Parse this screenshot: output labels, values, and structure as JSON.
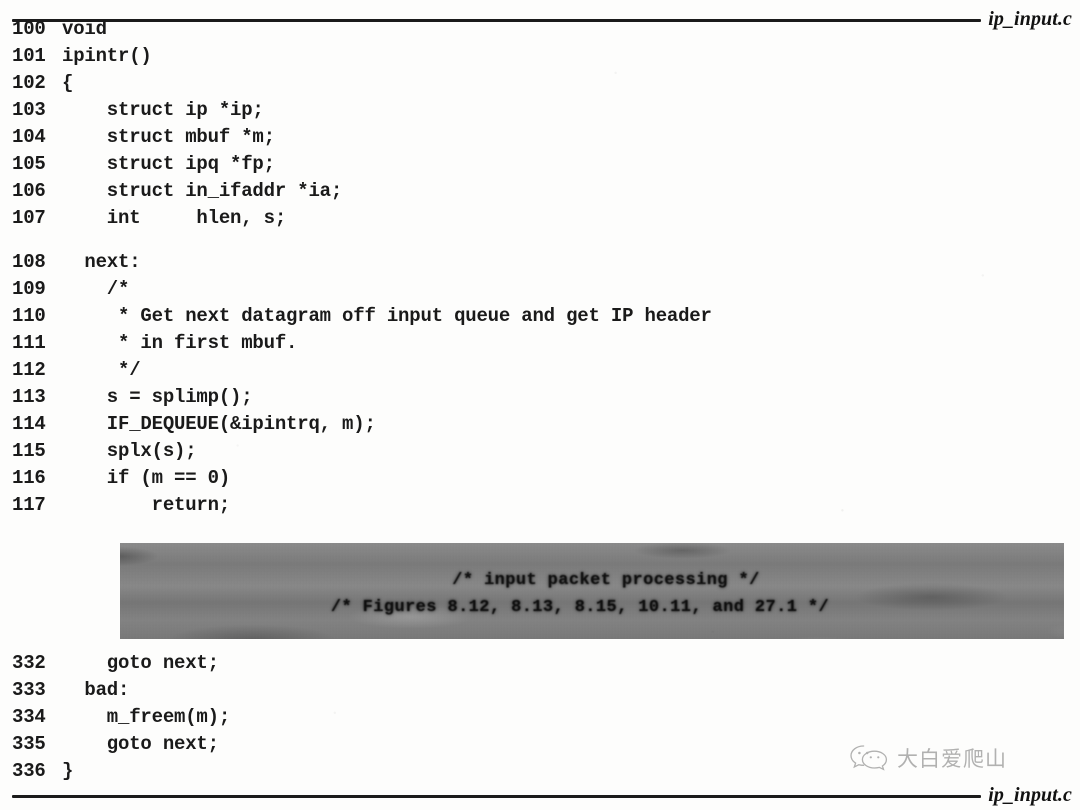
{
  "document": {
    "header_filename": "ip_input.c",
    "footer_filename": "ip_input.c"
  },
  "listing": {
    "lines": [
      {
        "num": "100",
        "code": "void"
      },
      {
        "num": "101",
        "code": "ipintr()"
      },
      {
        "num": "102",
        "code": "{"
      },
      {
        "num": "103",
        "code": "    struct ip *ip;"
      },
      {
        "num": "104",
        "code": "    struct mbuf *m;"
      },
      {
        "num": "105",
        "code": "    struct ipq *fp;"
      },
      {
        "num": "106",
        "code": "    struct in_ifaddr *ia;"
      },
      {
        "num": "107",
        "code": "    int     hlen, s;"
      },
      {
        "num": "108",
        "code": "  next:"
      },
      {
        "num": "109",
        "code": "    /*"
      },
      {
        "num": "110",
        "code": "     * Get next datagram off input queue and get IP header"
      },
      {
        "num": "111",
        "code": "     * in first mbuf."
      },
      {
        "num": "112",
        "code": "     */"
      },
      {
        "num": "113",
        "code": "    s = splimp();"
      },
      {
        "num": "114",
        "code": "    IF_DEQUEUE(&ipintrq, m);"
      },
      {
        "num": "115",
        "code": "    splx(s);"
      },
      {
        "num": "116",
        "code": "    if (m == 0)"
      },
      {
        "num": "117",
        "code": "        return;"
      }
    ],
    "lines_after": [
      {
        "num": "332",
        "code": "    goto next;"
      },
      {
        "num": "333",
        "code": "  bad:"
      },
      {
        "num": "334",
        "code": "    m_freem(m);"
      },
      {
        "num": "335",
        "code": "    goto next;"
      },
      {
        "num": "336",
        "code": "}"
      }
    ]
  },
  "elided_block": {
    "line1": "/* input packet processing */",
    "line2": "/* Figures 8.12, 8.13, 8.15, 10.11, and 27.1 */",
    "shade_color": "#808080"
  },
  "watermark": {
    "icon": "wechat-icon",
    "text": "大白爱爬山"
  }
}
